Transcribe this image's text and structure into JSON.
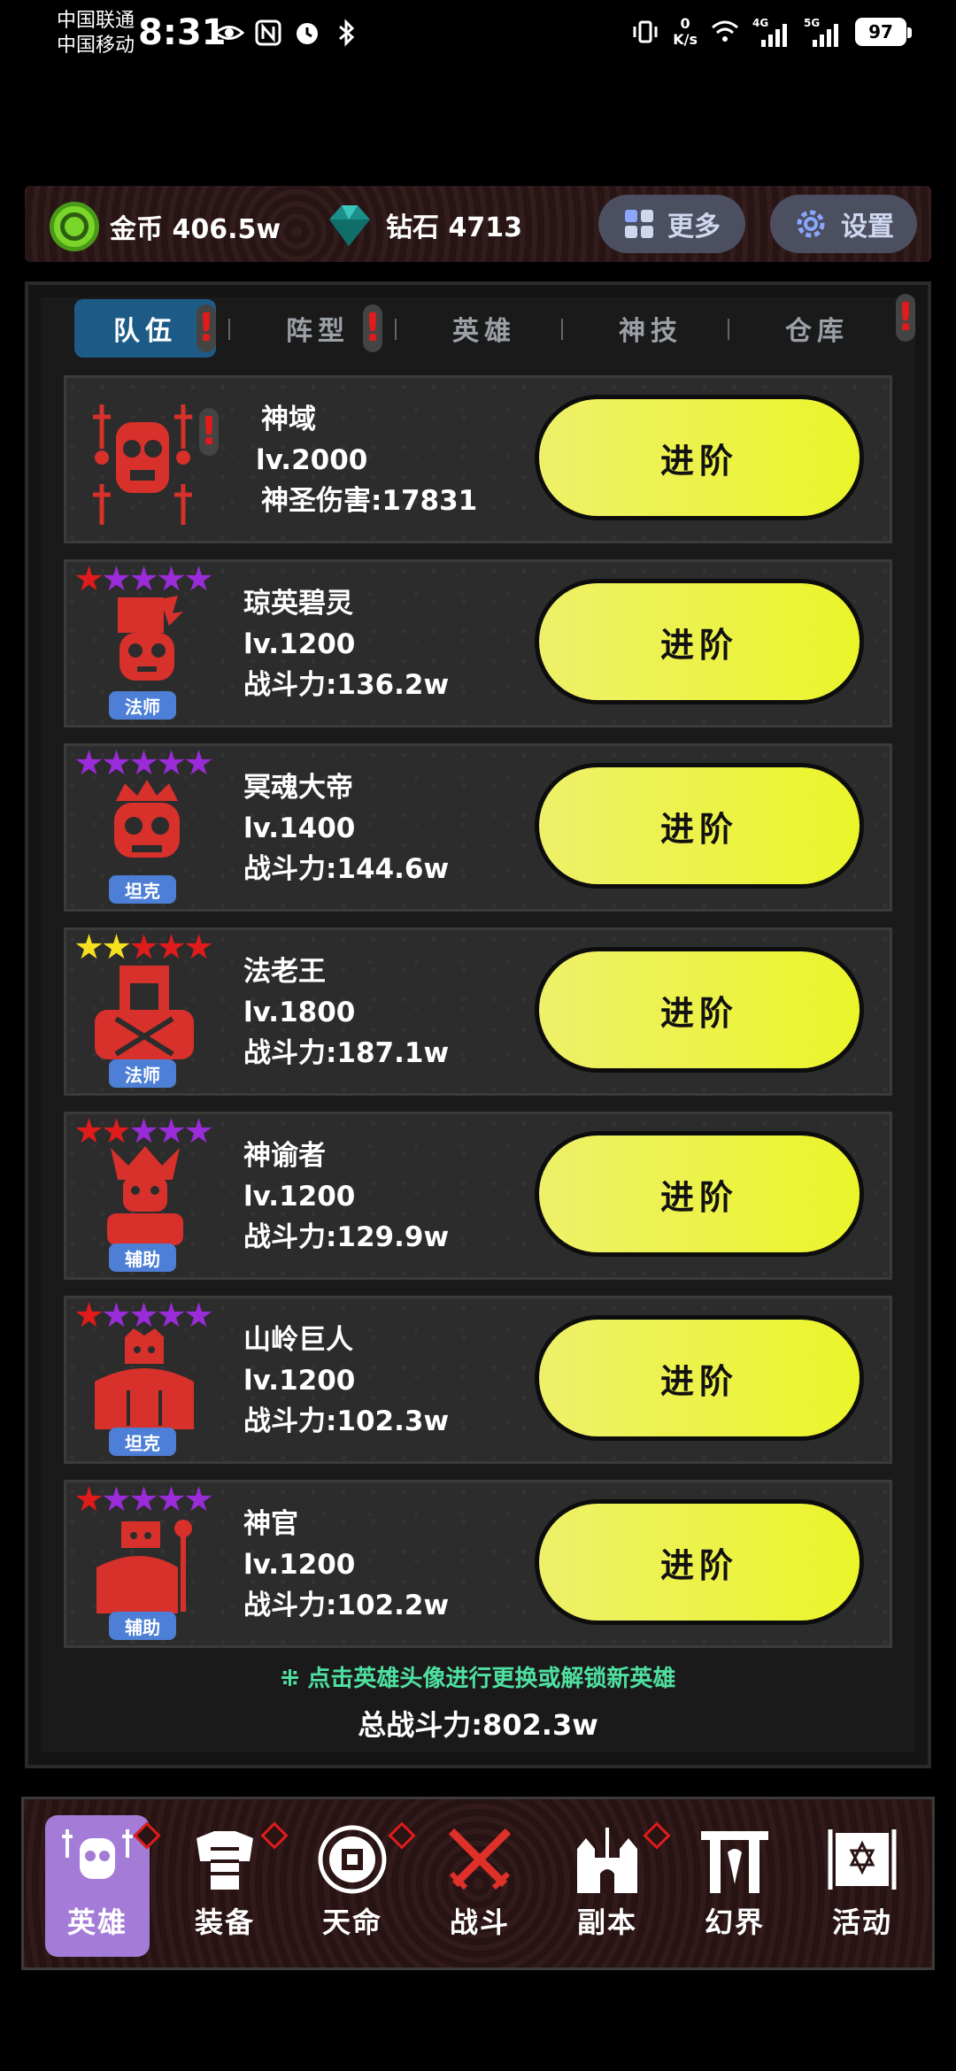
{
  "status": {
    "carrier1": "中国联通",
    "carrier2": "中国移动",
    "time": "8:31",
    "speed_value": "0",
    "speed_unit": "K/s",
    "net1": "4G",
    "net2": "5G",
    "battery": "97"
  },
  "resources": {
    "gold_label": "金币 406.5w",
    "diamond_label": "钻石 4713",
    "more_label": "更多",
    "settings_label": "设置"
  },
  "tabs": [
    "队伍",
    "阵型",
    "英雄",
    "神技",
    "仓库"
  ],
  "god": {
    "name": "神域",
    "level": "lv.2000",
    "damage": "神圣伤害:17831",
    "button": "进阶"
  },
  "heroes": [
    {
      "name": "琼英碧灵",
      "level": "lv.1200",
      "power": "战斗力:136.2w",
      "role": "法师",
      "button": "进阶",
      "stars": [
        "#e01b1b",
        "#9a2bd8",
        "#9a2bd8",
        "#9a2bd8",
        "#9a2bd8"
      ]
    },
    {
      "name": "冥魂大帝",
      "level": "lv.1400",
      "power": "战斗力:144.6w",
      "role": "坦克",
      "button": "进阶",
      "stars": [
        "#9a2bd8",
        "#9a2bd8",
        "#9a2bd8",
        "#9a2bd8",
        "#9a2bd8"
      ]
    },
    {
      "name": "法老王",
      "level": "lv.1800",
      "power": "战斗力:187.1w",
      "role": "法师",
      "button": "进阶",
      "stars": [
        "#f5e020",
        "#f5e020",
        "#e01b1b",
        "#e01b1b",
        "#e01b1b"
      ]
    },
    {
      "name": "神谕者",
      "level": "lv.1200",
      "power": "战斗力:129.9w",
      "role": "辅助",
      "button": "进阶",
      "stars": [
        "#e01b1b",
        "#e01b1b",
        "#9a2bd8",
        "#9a2bd8",
        "#9a2bd8"
      ]
    },
    {
      "name": "山岭巨人",
      "level": "lv.1200",
      "power": "战斗力:102.3w",
      "role": "坦克",
      "button": "进阶",
      "stars": [
        "#e01b1b",
        "#9a2bd8",
        "#9a2bd8",
        "#9a2bd8",
        "#9a2bd8"
      ]
    },
    {
      "name": "神官",
      "level": "lv.1200",
      "power": "战斗力:102.2w",
      "role": "辅助",
      "button": "进阶",
      "stars": [
        "#e01b1b",
        "#9a2bd8",
        "#9a2bd8",
        "#9a2bd8",
        "#9a2bd8"
      ]
    }
  ],
  "hint": "⁜ 点击英雄头像进行更换或解锁新英雄",
  "total": "总战斗力:802.3w",
  "nav": [
    "英雄",
    "装备",
    "天命",
    "战斗",
    "副本",
    "幻界",
    "活动"
  ],
  "colors": {
    "accent_tab": "#1d5a86",
    "button_yellow": "#ebf52a",
    "portrait_red": "#d8302a",
    "nav_active": "#a57bd8",
    "role_badge": "#4d7fd6"
  }
}
